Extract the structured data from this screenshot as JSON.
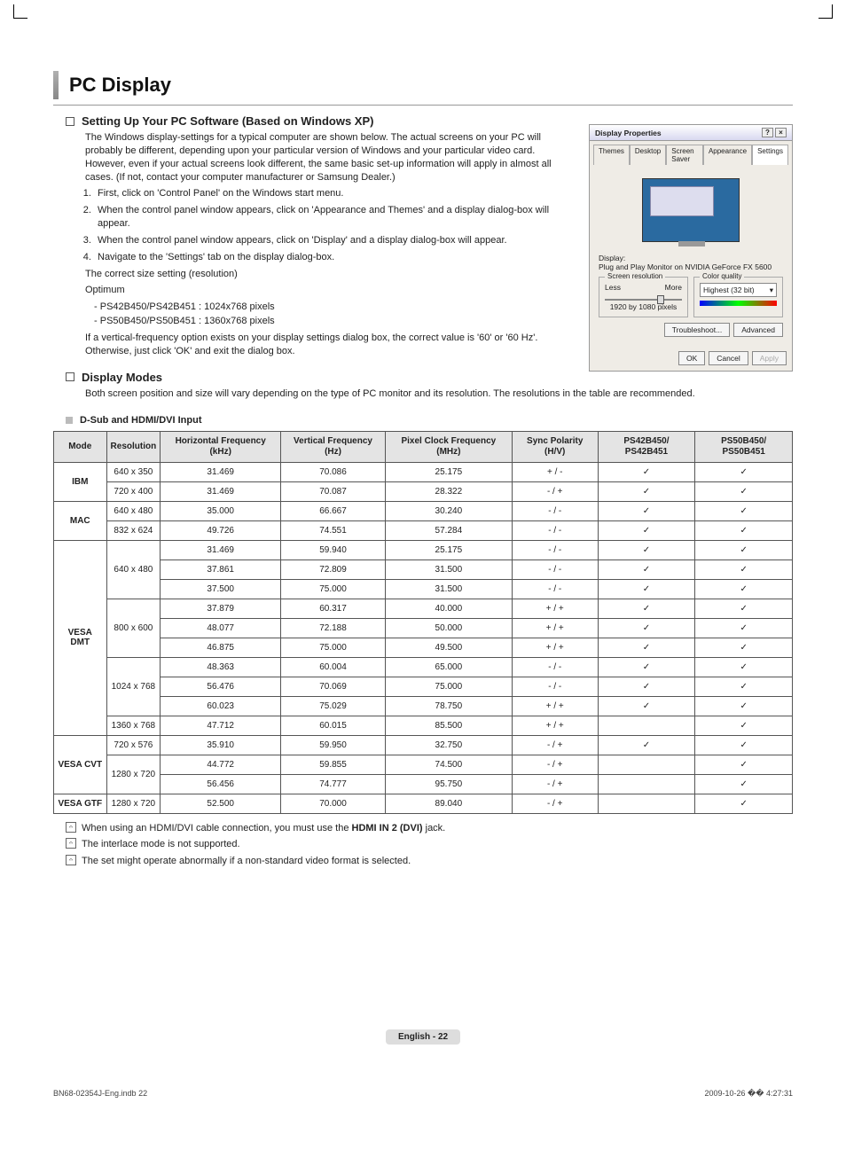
{
  "title": "PC Display",
  "section1": {
    "heading": "Setting Up Your PC Software (Based on Windows XP)",
    "intro": "The Windows display-settings for a typical computer are shown below. The actual screens on your PC will probably be different, depending upon your particular version of Windows and your particular video card. However, even if your actual screens look different, the same basic set-up information will apply in almost all cases. (If not, contact your computer manufacturer or Samsung Dealer.)",
    "steps": [
      "First, click on 'Control Panel' on the Windows start menu.",
      "When the control panel window appears, click on 'Appearance and Themes' and a display dialog-box will appear.",
      "When the control panel window appears, click on 'Display' and a display dialog-box will appear.",
      "Navigate to the 'Settings' tab on the display dialog-box."
    ],
    "resolution_lead": "The correct size setting (resolution)",
    "optimum": "Optimum",
    "res_lines": [
      "PS42B450/PS42B451 : 1024x768 pixels",
      "PS50B450/PS50B451 : 1360x768 pixels"
    ],
    "vfreq": "If a vertical-frequency option exists on your display settings dialog box, the correct value is '60' or '60 Hz'. Otherwise, just click 'OK' and exit the dialog box."
  },
  "section2": {
    "heading": "Display Modes",
    "intro": "Both screen position and size will vary depending on the type of PC monitor and its resolution. The resolutions in the table are recommended."
  },
  "table_heading": "D-Sub and HDMI/DVI Input",
  "table": {
    "headers": [
      "Mode",
      "Resolution",
      "Horizontal Frequency (kHz)",
      "Vertical Frequency (Hz)",
      "Pixel Clock Frequency (MHz)",
      "Sync Polarity (H/V)",
      "PS42B450/ PS42B451",
      "PS50B450/ PS50B451"
    ],
    "rows": [
      {
        "mode": "IBM",
        "modespan": 2,
        "res": "640 x 350",
        "hf": "31.469",
        "vf": "70.086",
        "pc": "25.175",
        "sp": "+ / -",
        "a": "✓",
        "b": "✓"
      },
      {
        "mode": "",
        "res": "720 x 400",
        "hf": "31.469",
        "vf": "70.087",
        "pc": "28.322",
        "sp": "- / +",
        "a": "✓",
        "b": "✓"
      },
      {
        "mode": "MAC",
        "modespan": 2,
        "res": "640 x 480",
        "hf": "35.000",
        "vf": "66.667",
        "pc": "30.240",
        "sp": "- / -",
        "a": "✓",
        "b": "✓"
      },
      {
        "mode": "",
        "res": "832 x 624",
        "hf": "49.726",
        "vf": "74.551",
        "pc": "57.284",
        "sp": "- / -",
        "a": "✓",
        "b": "✓"
      },
      {
        "mode": "VESA DMT",
        "modespan": 10,
        "res": "640 x 480",
        "resspan": 3,
        "hf": "31.469",
        "vf": "59.940",
        "pc": "25.175",
        "sp": "- / -",
        "a": "✓",
        "b": "✓"
      },
      {
        "mode": "",
        "res": "",
        "hf": "37.861",
        "vf": "72.809",
        "pc": "31.500",
        "sp": "- / -",
        "a": "✓",
        "b": "✓"
      },
      {
        "mode": "",
        "res": "",
        "hf": "37.500",
        "vf": "75.000",
        "pc": "31.500",
        "sp": "- / -",
        "a": "✓",
        "b": "✓"
      },
      {
        "mode": "",
        "res": "800 x 600",
        "resspan": 3,
        "hf": "37.879",
        "vf": "60.317",
        "pc": "40.000",
        "sp": "+ / +",
        "a": "✓",
        "b": "✓"
      },
      {
        "mode": "",
        "res": "",
        "hf": "48.077",
        "vf": "72.188",
        "pc": "50.000",
        "sp": "+ / +",
        "a": "✓",
        "b": "✓"
      },
      {
        "mode": "",
        "res": "",
        "hf": "46.875",
        "vf": "75.000",
        "pc": "49.500",
        "sp": "+ / +",
        "a": "✓",
        "b": "✓"
      },
      {
        "mode": "",
        "res": "1024 x 768",
        "resspan": 3,
        "hf": "48.363",
        "vf": "60.004",
        "pc": "65.000",
        "sp": "- / -",
        "a": "✓",
        "b": "✓"
      },
      {
        "mode": "",
        "res": "",
        "hf": "56.476",
        "vf": "70.069",
        "pc": "75.000",
        "sp": "- / -",
        "a": "✓",
        "b": "✓"
      },
      {
        "mode": "",
        "res": "",
        "hf": "60.023",
        "vf": "75.029",
        "pc": "78.750",
        "sp": "+ / +",
        "a": "✓",
        "b": "✓"
      },
      {
        "mode": "",
        "res": "1360 x 768",
        "hf": "47.712",
        "vf": "60.015",
        "pc": "85.500",
        "sp": "+ / +",
        "a": "",
        "b": "✓"
      },
      {
        "mode": "VESA CVT",
        "modespan": 3,
        "res": "720 x 576",
        "hf": "35.910",
        "vf": "59.950",
        "pc": "32.750",
        "sp": "- / +",
        "a": "✓",
        "b": "✓"
      },
      {
        "mode": "",
        "res": "1280 x 720",
        "resspan": 2,
        "hf": "44.772",
        "vf": "59.855",
        "pc": "74.500",
        "sp": "- / +",
        "a": "",
        "b": "✓"
      },
      {
        "mode": "",
        "res": "",
        "hf": "56.456",
        "vf": "74.777",
        "pc": "95.750",
        "sp": "- / +",
        "a": "",
        "b": "✓"
      },
      {
        "mode": "VESA GTF",
        "modespan": 1,
        "res": "1280 x 720",
        "hf": "52.500",
        "vf": "70.000",
        "pc": "89.040",
        "sp": "- / +",
        "a": "",
        "b": "✓"
      }
    ]
  },
  "notes": [
    {
      "pre": "When using an HDMI/DVI cable connection, you must use the ",
      "bold": "HDMI IN 2 (DVI)",
      "post": " jack."
    },
    {
      "pre": "The interlace mode is not supported.",
      "bold": "",
      "post": ""
    },
    {
      "pre": "The set might operate abnormally if a non-standard video format is selected.",
      "bold": "",
      "post": ""
    }
  ],
  "figure": {
    "title": "Display Properties",
    "tabs": [
      "Themes",
      "Desktop",
      "Screen Saver",
      "Appearance",
      "Settings"
    ],
    "display_label": "Display:",
    "display_value": "Plug and Play Monitor on NVIDIA GeForce FX 5600",
    "screen_res": "Screen resolution",
    "less": "Less",
    "more": "More",
    "res_value": "1920 by 1080 pixels",
    "color_quality": "Color quality",
    "color_value": "Highest (32 bit)",
    "troubleshoot": "Troubleshoot...",
    "advanced": "Advanced",
    "ok": "OK",
    "cancel": "Cancel",
    "apply": "Apply"
  },
  "footer": {
    "page": "English - 22",
    "left": "BN68-02354J-Eng.indb   22",
    "right": "2009-10-26   �� 4:27:31"
  }
}
